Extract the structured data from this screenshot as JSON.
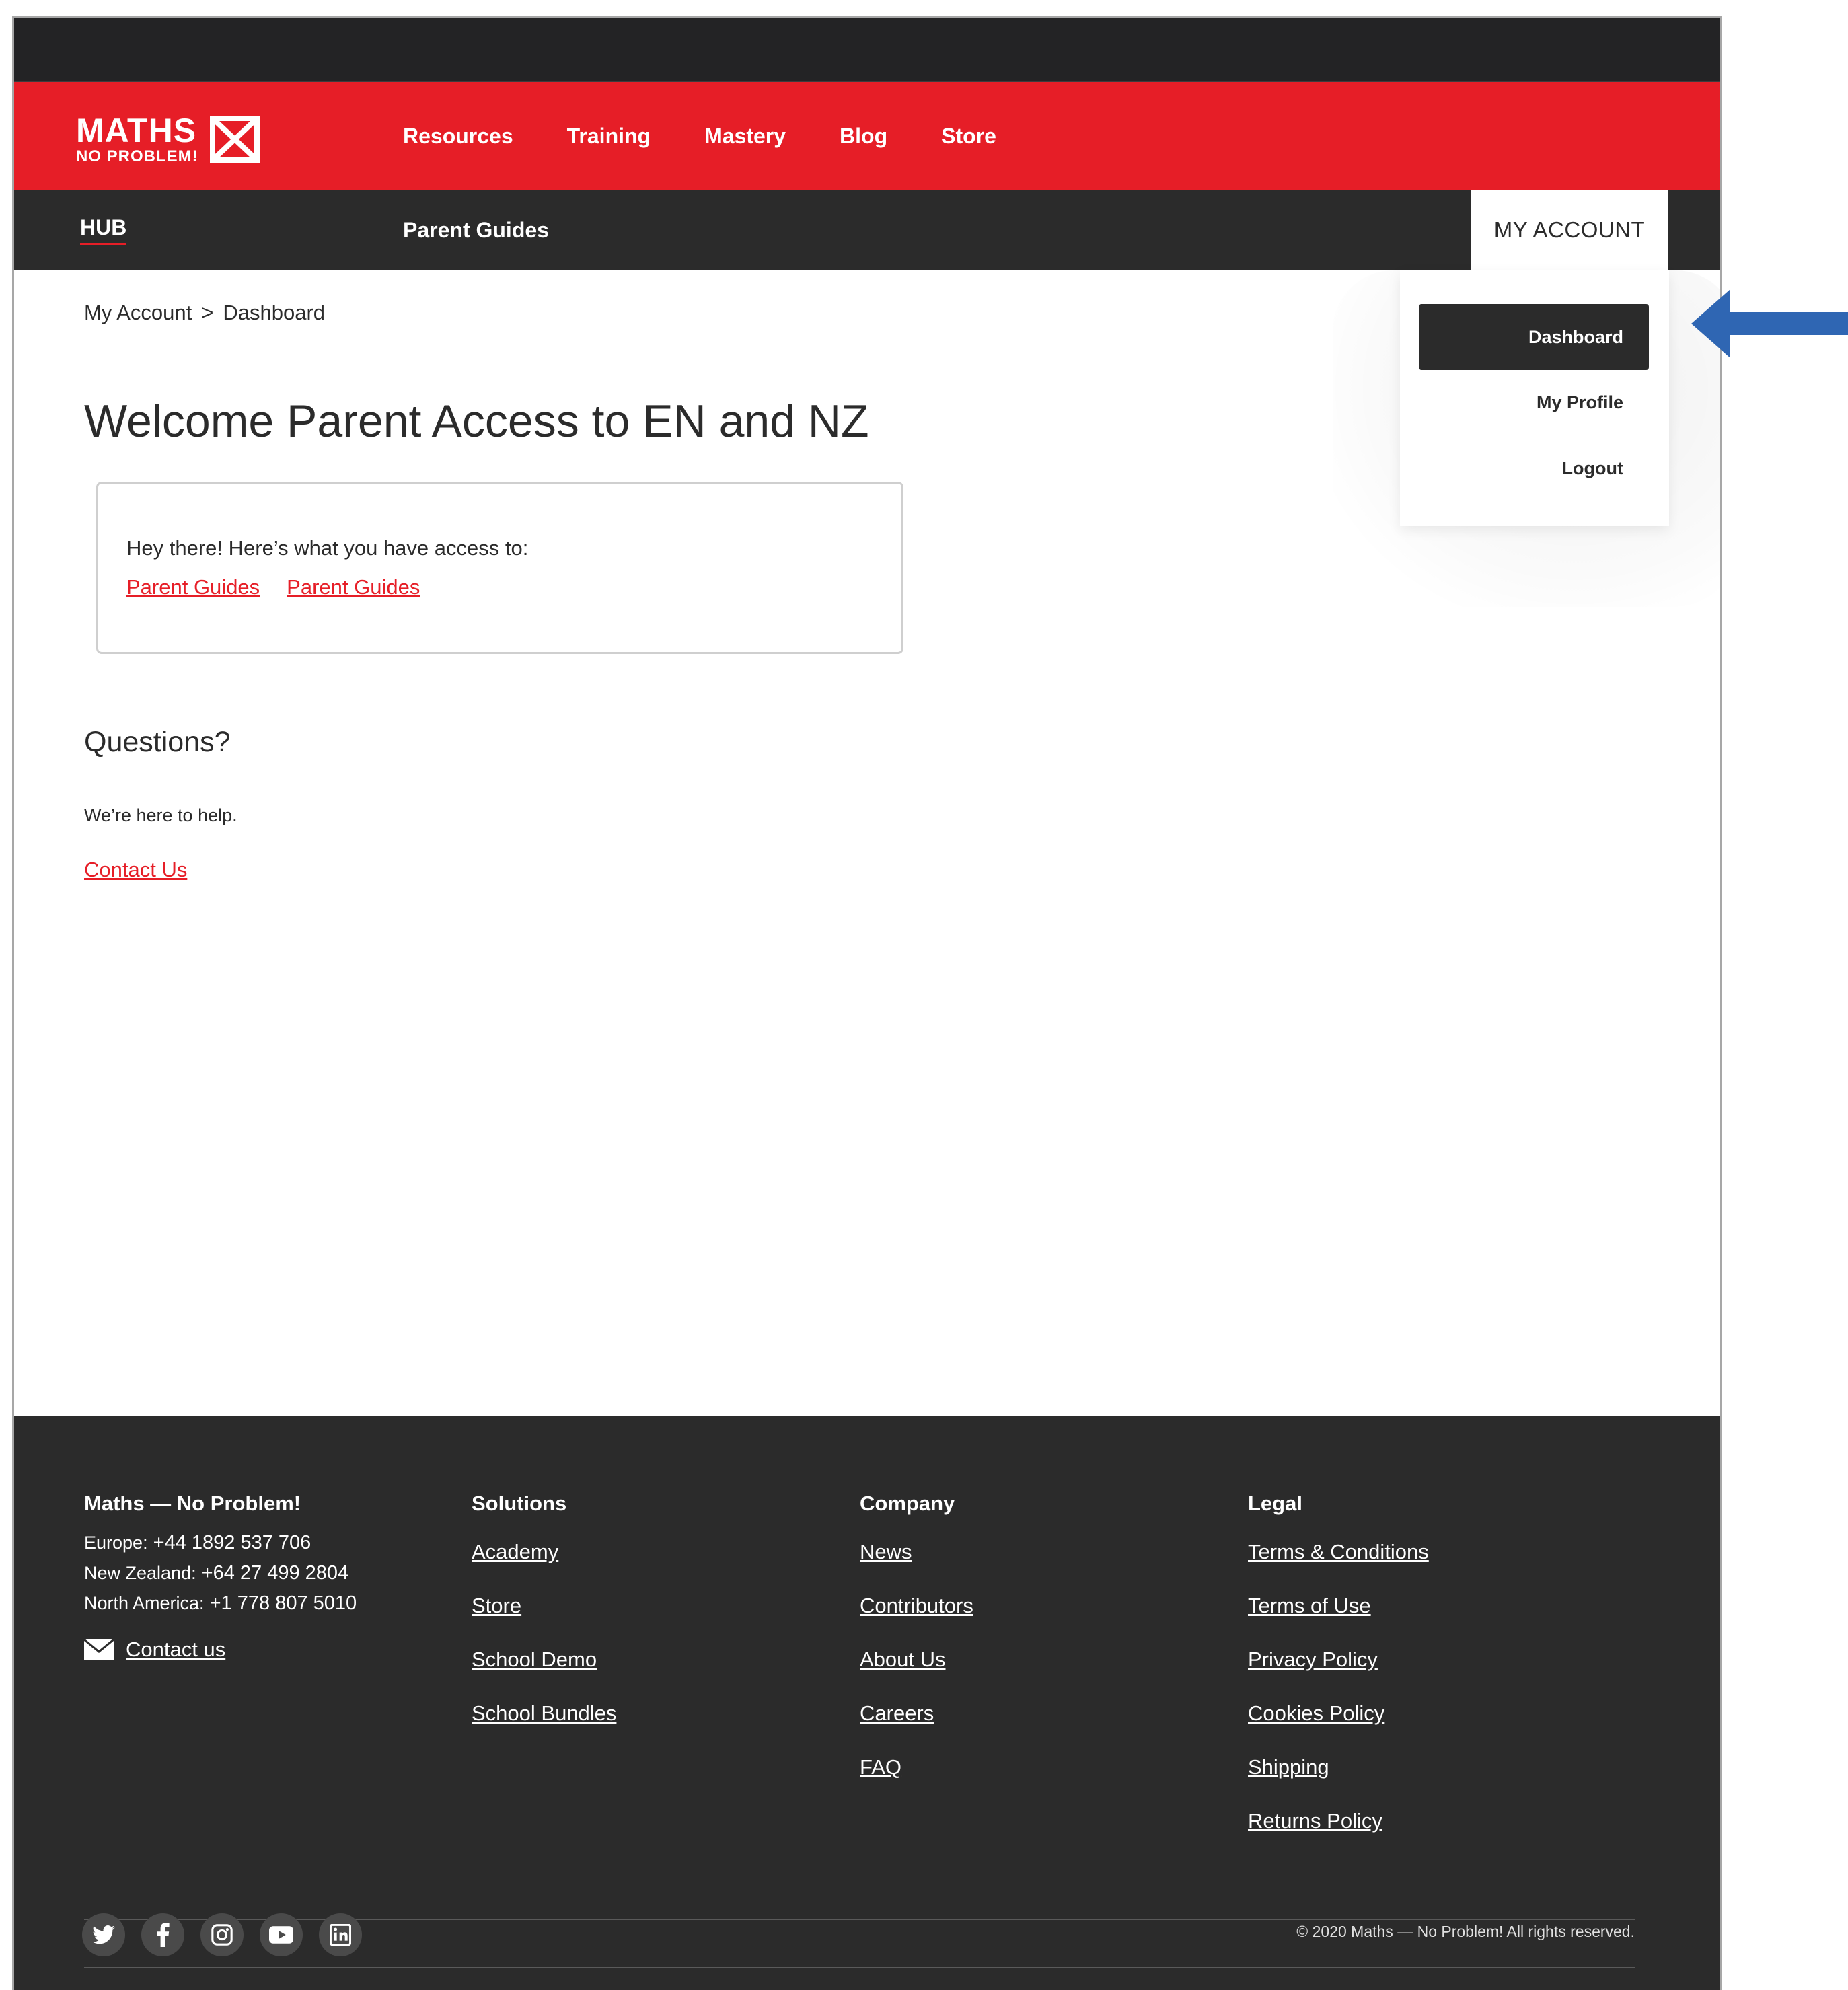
{
  "header": {
    "logo_main": "MATHS",
    "logo_sub": "NO PROBLEM!",
    "nav": [
      "Resources",
      "Training",
      "Mastery",
      "Blog",
      "Store"
    ],
    "hub": "HUB",
    "sub_nav": "Parent Guides",
    "my_account": "MY ACCOUNT"
  },
  "dropdown": {
    "items": [
      "Dashboard",
      "My Profile",
      "Logout"
    ],
    "active": "Dashboard"
  },
  "breadcrumb": {
    "parent": "My Account",
    "separator": ">",
    "current": "Dashboard"
  },
  "main": {
    "title": "Welcome Parent Access to EN and NZ",
    "card_text": "Hey there! Here’s what you have access to:",
    "card_links": [
      "Parent Guides",
      "Parent Guides"
    ],
    "questions_heading": "Questions?",
    "help_text": "We’re here to help.",
    "contact_link": "Contact Us"
  },
  "footer": {
    "brand": "Maths — No Problem!",
    "phones": [
      {
        "label": "Europe:",
        "number": "+44 1892 537 706"
      },
      {
        "label": "New Zealand:",
        "number": "+64 27 499 2804"
      },
      {
        "label": "North America:",
        "number": "+1 778 807 5010"
      }
    ],
    "contact": "Contact us",
    "solutions": {
      "heading": "Solutions",
      "links": [
        "Academy",
        "Store",
        "School Demo",
        "School Bundles"
      ]
    },
    "company": {
      "heading": "Company",
      "links": [
        "News",
        "Contributors",
        "About Us",
        "Careers",
        "FAQ"
      ]
    },
    "legal": {
      "heading": "Legal",
      "links": [
        "Terms & Conditions",
        "Terms of Use",
        "Privacy Policy",
        "Cookies Policy",
        "Shipping",
        "Returns Policy"
      ]
    },
    "copyright": "© 2020 Maths — No Problem! All rights reserved.",
    "socials": [
      "twitter-icon",
      "facebook-icon",
      "instagram-icon",
      "youtube-icon",
      "linkedin-icon"
    ]
  },
  "colors": {
    "brand_red": "#e61e27",
    "dark": "#2b2b2b",
    "arrow_blue": "#2f66b3"
  }
}
